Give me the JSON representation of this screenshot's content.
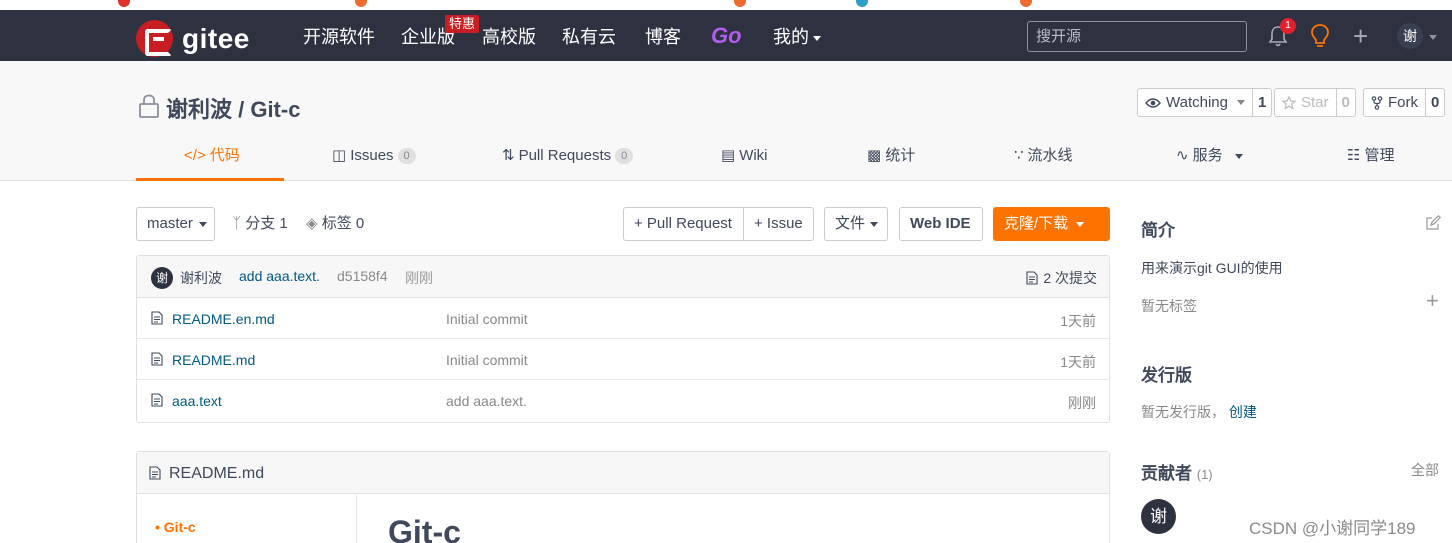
{
  "colors": {
    "nav_bg": "#2e3140",
    "accent_orange": "#fe7300",
    "brand_red": "#c71d23",
    "link_blue": "#005980",
    "go_purple": "#b35cf0"
  },
  "navbar": {
    "brand": "gitee",
    "items": [
      "开源软件",
      "企业版",
      "高校版",
      "私有云",
      "博客"
    ],
    "enterprise_badge": "特惠",
    "go_label": "Go",
    "mine_label": "我的",
    "search_placeholder": "搜开源",
    "notification_count": "1",
    "avatar_text": "谢"
  },
  "project": {
    "title": "谢利波 / Git-c",
    "watching_label": "Watching",
    "watching_count": "1",
    "star_label": "Star",
    "star_count": "0",
    "fork_label": "Fork",
    "fork_count": "0"
  },
  "tabs": [
    {
      "label": "代码",
      "count": null
    },
    {
      "label": "Issues",
      "count": "0"
    },
    {
      "label": "Pull Requests",
      "count": "0"
    },
    {
      "label": "Wiki",
      "count": null
    },
    {
      "label": "统计",
      "count": null
    },
    {
      "label": "流水线",
      "count": null
    },
    {
      "label": "服务",
      "count": null
    },
    {
      "label": "管理",
      "count": null
    }
  ],
  "toolbar": {
    "branch": "master",
    "branches_label": "分支 1",
    "tags_label": "标签 0",
    "pull_request_label": "+ Pull Request",
    "issue_label": "+ Issue",
    "file_label": "文件",
    "web_ide_label": "Web IDE",
    "clone_label": "克隆/下载"
  },
  "commit": {
    "avatar": "谢",
    "author": "谢利波",
    "message": "add aaa.text.",
    "sha": "d5158f4",
    "time": "刚刚",
    "count_label": "2 次提交"
  },
  "files": [
    {
      "name": "README.en.md",
      "message": "Initial commit",
      "time": "1天前"
    },
    {
      "name": "README.md",
      "message": "Initial commit",
      "time": "1天前"
    },
    {
      "name": "aaa.text",
      "message": "add aaa.text.",
      "time": "刚刚"
    }
  ],
  "readme": {
    "title": "README.md",
    "toc_item": "Git-c",
    "heading": "Git-c"
  },
  "sidebar": {
    "intro_title": "简介",
    "intro_text": "用来演示git GUI的使用",
    "no_tags": "暂无标签",
    "release_title": "发行版",
    "no_release": "暂无发行版，",
    "create_link": "创建",
    "contributors_title": "贡献者",
    "contributors_count": "(1)",
    "all_label": "全部",
    "contributor_avatar": "谢"
  },
  "watermark": "CSDN @小谢同学189"
}
